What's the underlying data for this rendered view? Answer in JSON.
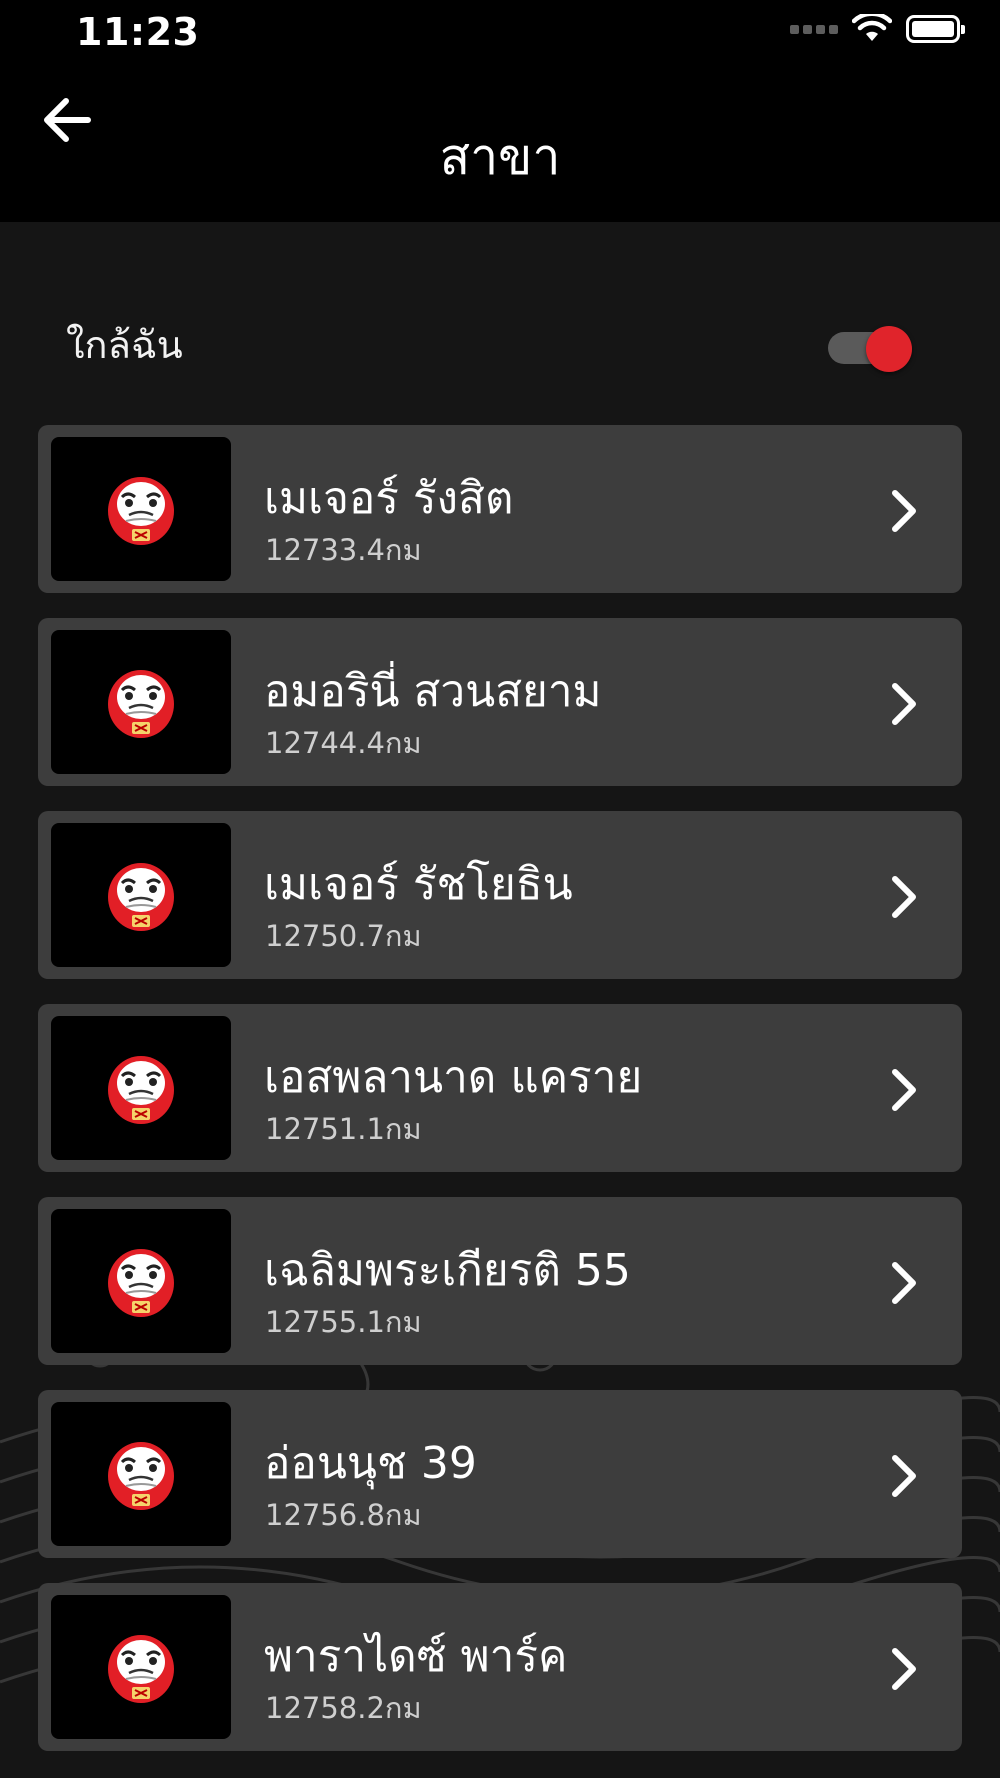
{
  "status_bar": {
    "time": "11:23"
  },
  "header": {
    "title": "สาขา",
    "back_icon": "arrow-left-icon"
  },
  "near_me": {
    "label": "ใกล้ฉัน",
    "toggle_on": true,
    "accent_color": "#e0242b"
  },
  "branches": [
    {
      "name": "เมเจอร์ รังสิต",
      "distance": "12733.4กม"
    },
    {
      "name": "อมอรินี่ สวนสยาม",
      "distance": "12744.4กม"
    },
    {
      "name": "เมเจอร์ รัชโยธิน",
      "distance": "12750.7กม"
    },
    {
      "name": "เอสพลานาด แคราย",
      "distance": "12751.1กม"
    },
    {
      "name": "เฉลิมพระเกียรติ 55",
      "distance": "12755.1กม"
    },
    {
      "name": "อ่อนนุช 39",
      "distance": "12756.8กม"
    },
    {
      "name": "พาราไดซ์ พาร์ค",
      "distance": "12758.2กม"
    }
  ],
  "colors": {
    "background": "#151515",
    "card": "#3d3d3d",
    "header": "#000000"
  }
}
